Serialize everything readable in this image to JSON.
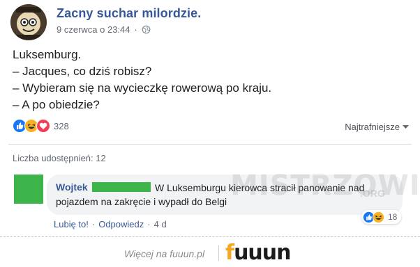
{
  "post": {
    "page_name": "Zacny suchar milordzie.",
    "timestamp": "9 czerwca o 23:44",
    "separator": "·",
    "lines": [
      "Luksemburg.",
      "– Jacques, co dziś robisz?",
      "– Wybieram się na wycieczkę rowerową po kraju.",
      "– A po obiedzie?"
    ],
    "reaction_count": "328",
    "sort_label": "Najtrafniejsze",
    "shares_label": "Liczba udostępnień: 12"
  },
  "comment": {
    "author": "Wojtek",
    "text": "W Luksemburgu kierowca stracił panowanie nad pojazdem na zakręcie i wypadł do Belgi",
    "reaction_count": "18",
    "like_label": "Lubię to!",
    "reply_label": "Odpowiedz",
    "age": "4 d",
    "dot": "·"
  },
  "watermark": {
    "main": "MISTRZOWIE",
    "sub": ".ORG"
  },
  "footer": {
    "text": "Więcej na fuuun.pl",
    "logo_prefix": "f",
    "logo_rest": "uuun"
  },
  "colors": {
    "link": "#365899",
    "like": "#1877f2",
    "haha": "#f7b125",
    "love": "#f33e58",
    "redacted": "#3cb44a"
  },
  "icons": [
    "avatar-icon",
    "globe-icon",
    "like-icon",
    "haha-icon",
    "love-icon",
    "caret-down-icon"
  ]
}
